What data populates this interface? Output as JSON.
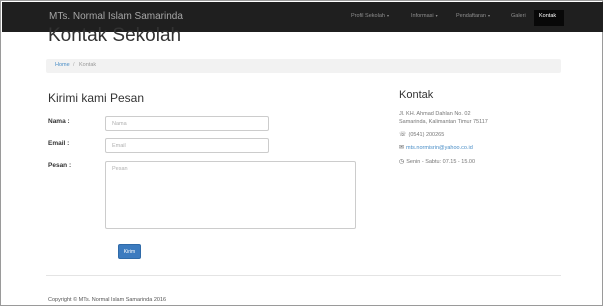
{
  "navbar": {
    "brand": "MTs. Normal Islam Samarinda",
    "items": [
      {
        "label": "Profil Sekolah",
        "dropdown": true
      },
      {
        "label": "Informasi",
        "dropdown": true
      },
      {
        "label": "Pendaftaran",
        "dropdown": true
      },
      {
        "label": "Galeri",
        "dropdown": false
      },
      {
        "label": "Kontak",
        "dropdown": false,
        "active": true
      }
    ],
    "caret": "▾"
  },
  "page": {
    "title": "Kontak Sekolah"
  },
  "breadcrumb": {
    "home": "Home",
    "separator": "/",
    "current": "Kontak"
  },
  "form": {
    "title": "Kirimi kami Pesan",
    "name_label": "Nama :",
    "name_placeholder": "Nama",
    "email_label": "Email :",
    "email_placeholder": "Email",
    "message_label": "Pesan :",
    "message_placeholder": "Pesan",
    "submit_label": "Kirim"
  },
  "contact": {
    "title": "Kontak",
    "address_line1": "Jl. KH. Ahmad Dahlan No. 02",
    "address_line2": "Samarinda, Kalimantan Timur 75117",
    "phone": "(0541) 200265",
    "email": "mts.normisrin@yahoo.co.id",
    "hours": "Senin - Sabtu: 07.15 - 15.00",
    "icons": [
      "phone-icon",
      "envelope-icon",
      "clock-icon"
    ]
  },
  "footer": {
    "copyright": "Copyright © MTs. Normal Islam Samarinda 2016"
  },
  "colors": {
    "navbar_bg": "#1f1f1f",
    "link": "#4a8ec7",
    "button": "#3c7bbf",
    "breadcrumb_bg": "#f2f2f2"
  }
}
